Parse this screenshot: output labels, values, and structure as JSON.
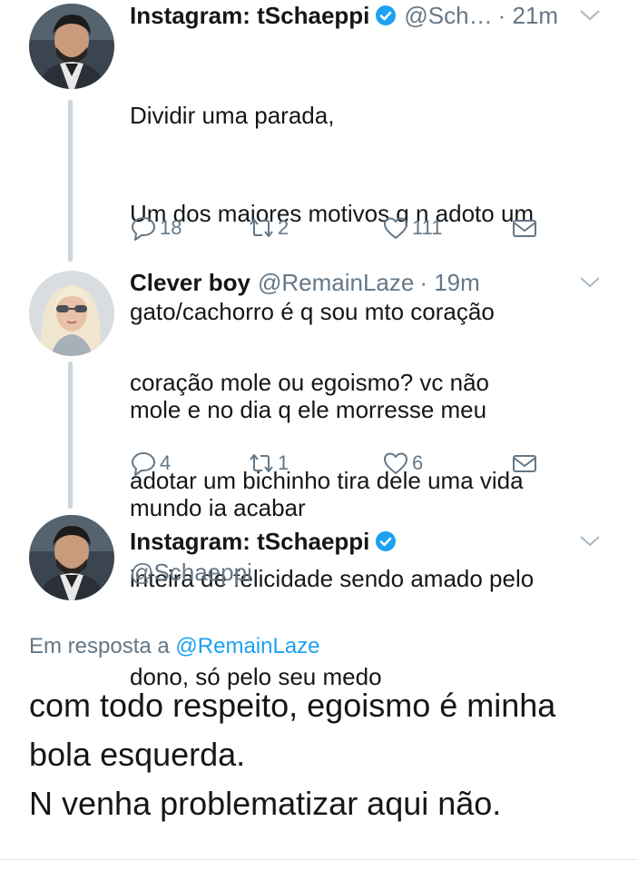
{
  "tweet1": {
    "name": "Instagram: tSchaeppi",
    "handle": "@Sch…",
    "time": "· 21m",
    "lines": [
      "Dividir uma parada,",
      "Um dos maiores motivos q n adoto um",
      "gato/cachorro é q sou mto coração",
      "mole e no dia q ele morresse meu",
      "mundo ia acabar"
    ],
    "reply_count": "18",
    "retweet_count": "2",
    "like_count": "111"
  },
  "tweet2": {
    "name": "Clever boy",
    "handle": "@RemainLaze",
    "time": "· 19m",
    "lines": [
      "coração mole ou egoismo? vc não",
      "adotar um bichinho tira dele uma vida",
      "inteira de felicidade sendo amado pelo",
      "dono, só pelo seu medo"
    ],
    "reply_count": "4",
    "retweet_count": "1",
    "like_count": "6"
  },
  "tweet3": {
    "name": "Instagram: tSchaeppi",
    "handle": "@Schaeppi",
    "replying_prefix": "Em resposta a",
    "replying_to": "@RemainLaze",
    "lines": [
      "com todo respeito, egoismo é minha",
      "bola esquerda.",
      "N venha problematizar aqui não."
    ]
  },
  "colors": {
    "text": "#14171a",
    "secondary": "#657786",
    "link": "#1da1f2",
    "verified": "#1da1f2",
    "thread_line": "#ccd6dd"
  },
  "icons": [
    "reply-icon",
    "retweet-icon",
    "like-icon",
    "dm-icon",
    "verified-icon",
    "chevron-down-icon"
  ]
}
